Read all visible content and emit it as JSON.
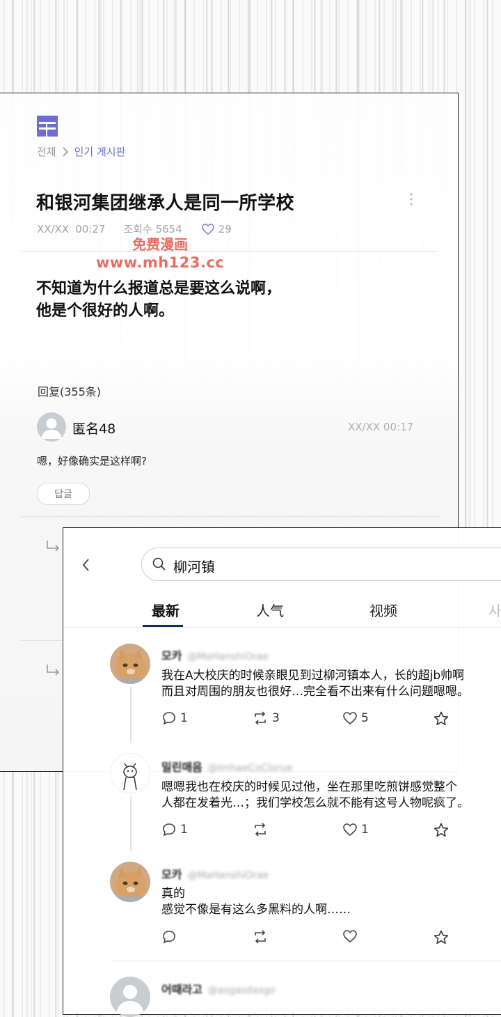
{
  "colors": {
    "accent": "#6b6fd1",
    "like_icon": "#9a9ad8",
    "watermark": "#e23b2e",
    "tab_underline": "#1d2a4f"
  },
  "forum": {
    "breadcrumb": {
      "root": "전체",
      "current": "인기 게시판"
    },
    "post": {
      "title": "和银河集团继承人是同一所学校",
      "date": "XX/XX",
      "time": "00:27",
      "views": "조회수 5654",
      "likes": "29",
      "body_line1": "不知道为什么报道总是要这么说啊，",
      "body_line2": "他是个很好的人啊。"
    },
    "watermark": {
      "line1": "免费漫画",
      "line2": "www.mh123.cc"
    },
    "replies_header": "回复(355条)",
    "comment": {
      "author": "匿名48",
      "timestamp": "XX/XX  00:17",
      "text": "嗯，好像确实是这样啊?",
      "reply_button": "답글"
    }
  },
  "search_app": {
    "query": "柳河镇",
    "tabs": [
      "最新",
      "人气",
      "视频",
      "사"
    ],
    "posts": [
      {
        "name": "모카",
        "handle": "@MaHanshiOrae",
        "text_line1": "我在A大校庆的时候亲眼见到过柳河镇本人，长的超jb帅啊",
        "text_line2": "而且对周围的朋友也很好…完全看不出来有什么问题嗯嗯。",
        "replies": "1",
        "retweets": "3",
        "likes": "5",
        "avatar": "cat"
      },
      {
        "name": "밀린매음",
        "handle": "@ImhaeCoClorue",
        "text_line1": "嗯嗯我也在校庆的时候见过他，坐在那里吃煎饼感觉整个",
        "text_line2": "人都在发着光…；我们学校怎么就不能有这号人物呢疯了。",
        "replies": "1",
        "retweets": "",
        "likes": "1",
        "avatar": "drawing"
      },
      {
        "name": "모카",
        "handle": "@MaHanshiOrae",
        "text_line1": "真的",
        "text_line2": "感觉不像是有这么多黑料的人啊……",
        "replies": "",
        "retweets": "",
        "likes": "",
        "avatar": "cat"
      },
      {
        "name": "어때라고",
        "handle": "@asgasdasgo",
        "avatar": "gray"
      }
    ]
  }
}
